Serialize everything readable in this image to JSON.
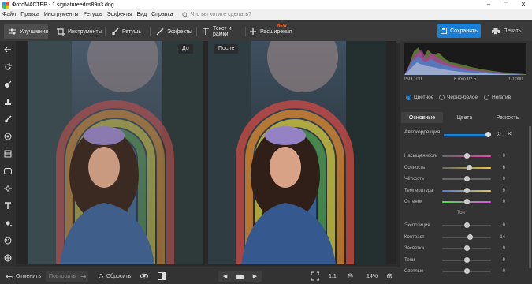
{
  "window": {
    "title": "ФотоМАСТЕР - 1 signatureedits89u3.dng"
  },
  "menu": {
    "items": [
      "Файл",
      "Правка",
      "Инструменты",
      "Ретушь",
      "Эффекты",
      "Вид",
      "Справка"
    ],
    "ask_placeholder": "Что вы хотите сделать?"
  },
  "toolbar": {
    "tabs": [
      {
        "label": "Улучшения",
        "icon": "sliders-icon"
      },
      {
        "label": "Инструменты",
        "icon": "crop-icon"
      },
      {
        "label": "Ретушь",
        "icon": "brush-icon"
      },
      {
        "label": "Эффекты",
        "icon": "wand-icon"
      },
      {
        "label": "Текст и рамки",
        "icon": "text-icon"
      },
      {
        "label": "Расширения",
        "icon": "plus-icon"
      }
    ],
    "new_badge": "NEW",
    "save_label": "Сохранить",
    "print_label": "Печать"
  },
  "canvas": {
    "before_label": "До",
    "after_label": "После"
  },
  "bottombar": {
    "undo": "Отменить",
    "redo": "Повторить",
    "reset": "Сбросить",
    "zoom_ratio": "1:1",
    "zoom_value": "14%"
  },
  "exif": {
    "iso": "ISO 100",
    "lens": "6 mm f/2.5",
    "shutter": "1/1000"
  },
  "modes": {
    "color": "Цветное",
    "bw": "Черно-белое",
    "negative": "Негатив",
    "selected": "Цветное"
  },
  "panel_tabs": {
    "basic": "Основные",
    "color": "Цвета",
    "sharpness": "Резкость",
    "active": "Основные"
  },
  "autocorrection": {
    "label": "Автокоррекция"
  },
  "sliders": [
    {
      "name": "Насыщенность",
      "value": "0",
      "pos": 0.5
    },
    {
      "name": "Сочность",
      "value": "6",
      "pos": 0.55
    },
    {
      "name": "Чёткость",
      "value": "0",
      "pos": 0.5
    },
    {
      "name": "Температура",
      "value": "0",
      "pos": 0.5
    },
    {
      "name": "Оттенок",
      "value": "0",
      "pos": 0.5
    }
  ],
  "tone": {
    "label": "Тон",
    "sliders": [
      {
        "name": "Экспозиция",
        "value": "0",
        "pos": 0.5
      },
      {
        "name": "Контраст",
        "value": "14",
        "pos": 0.57
      },
      {
        "name": "Засветки",
        "value": "0",
        "pos": 0.5
      },
      {
        "name": "Тени",
        "value": "0",
        "pos": 0.5
      },
      {
        "name": "Светлые",
        "value": "0",
        "pos": 0.5
      }
    ]
  },
  "colors": {
    "accent": "#1a7fd6",
    "new_badge": "#ff6a2b"
  }
}
